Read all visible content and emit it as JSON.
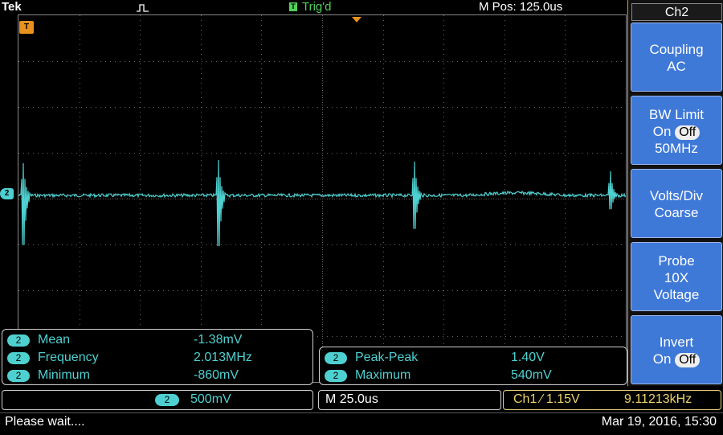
{
  "header": {
    "brand": "Tek",
    "trigger_status": "Trig'd",
    "horizontal_position": "M Pos: 125.0us"
  },
  "markers": {
    "trigger": "T",
    "channel": "2"
  },
  "colors": {
    "trace": "#4fd0d0",
    "trigger": "#e8911c",
    "trig_status": "#4fd15a",
    "menu_button": "#3f79d8",
    "trigger_readout": "#ecd46a"
  },
  "measurements_left": [
    {
      "channel": "2",
      "label": "Mean",
      "value": "-1.38mV"
    },
    {
      "channel": "2",
      "label": "Frequency",
      "value": "2.013MHz"
    },
    {
      "channel": "2",
      "label": "Minimum",
      "value": "-860mV"
    }
  ],
  "measurements_right": [
    {
      "channel": "2",
      "label": "Peak-Peak",
      "value": "1.40V"
    },
    {
      "channel": "2",
      "label": "Maximum",
      "value": "540mV"
    }
  ],
  "readouts": {
    "channel": "2",
    "vertical_scale": "500mV",
    "timebase": "M 25.0us",
    "trigger_source": "Ch1 ∕ 1.15V",
    "trigger_frequency": "9.11213kHz"
  },
  "status": {
    "message": "Please wait....",
    "datetime": "Mar 19, 2016, 15:30"
  },
  "menu": {
    "title": "Ch2",
    "coupling": {
      "label": "Coupling",
      "value": "AC"
    },
    "bw_limit": {
      "label": "BW Limit",
      "on": "On",
      "off": "Off",
      "value": "50MHz"
    },
    "volts_div": {
      "label": "Volts/Div",
      "value": "Coarse"
    },
    "probe": {
      "label": "Probe",
      "ratio": "10X",
      "type": "Voltage"
    },
    "invert": {
      "label": "Invert",
      "on": "On",
      "off": "Off"
    }
  }
}
